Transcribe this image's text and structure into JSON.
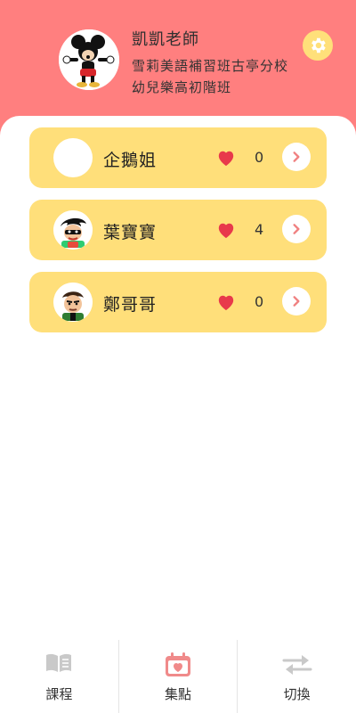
{
  "header": {
    "teacher_name": "凱凱老師",
    "school_line1": "雪莉美語補習班古亭分校",
    "school_line2": "幼兒樂高初階班",
    "avatar_icon": "mickey-avatar-icon",
    "settings_icon": "gear-icon"
  },
  "students": [
    {
      "name": "企鵝姐",
      "count": "0",
      "avatar": "blank-avatar"
    },
    {
      "name": "葉寶寶",
      "count": "4",
      "avatar": "robin-avatar-icon"
    },
    {
      "name": "鄭哥哥",
      "count": "0",
      "avatar": "ben-avatar-icon"
    }
  ],
  "tabs": [
    {
      "label": "課程",
      "icon": "book-icon"
    },
    {
      "label": "集點",
      "icon": "calendar-heart-icon"
    },
    {
      "label": "切換",
      "icon": "switch-arrows-icon"
    }
  ],
  "colors": {
    "header_bg": "#FF7F7F",
    "card_bg": "#FFDF7A",
    "heart": "#E8394B",
    "arrow": "#F08080",
    "active_tab_icon": "#F08A8A",
    "inactive_tab_icon": "#C9C9C9"
  }
}
